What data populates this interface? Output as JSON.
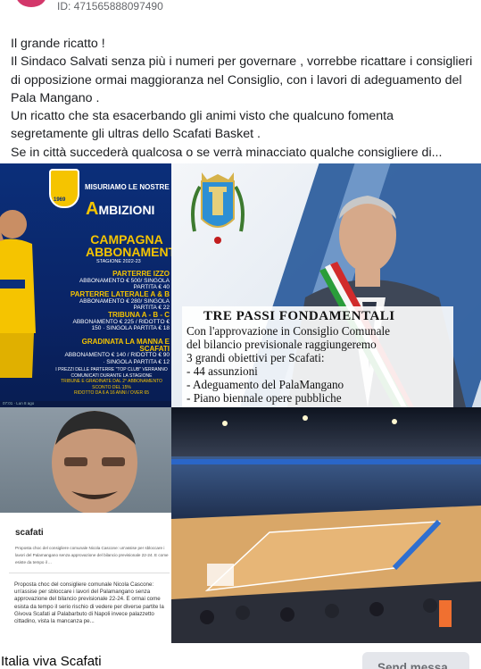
{
  "header": {
    "post_id": "ID: 471565888097490"
  },
  "post": {
    "lines": [
      "Il grande ricatto !",
      "Il Sindaco Salvati senza più i numeri per governare , vorrebbe ricattare i consiglieri",
      "di opposizione ormai maggioranza nel Consiglio, con i lavori di adeguamento del",
      "Pala Mangano .",
      "Un ricatto che sta esacerbando gli animi visto che qualcuno fomenta",
      "segretamente gli ultras dello Scafati Basket .",
      "Se in città succederà qualcosa o se verrà minacciato qualche consigliere di..."
    ]
  },
  "poster": {
    "badge": "SCAFATI BASKET",
    "year": "1969",
    "slogan_small": "MISURIAMO LE NOSTRE",
    "slogan_big": "MBIZIONI",
    "slogan_letter": "A",
    "campaign": "CAMPAGNA ABBONAMENTI",
    "season": "STAGIONE 2022-23",
    "rows": [
      {
        "head": "PARTERRE IZZO",
        "detail": "ABBONAMENTO € 500/ SINGOLA PARTITA € 40"
      },
      {
        "head": "PARTERRE LATERALE A & B",
        "detail": "ABBONAMENTO € 280/ SINGOLA PARTITA € 22"
      },
      {
        "head": "TRIBUNA A - B - C",
        "detail": "ABBONAMENTO € 225 / RIDOTTO € 150 · SINGOLA PARTITA € 18"
      },
      {
        "head": "GRADINATA LA MANNA E SCAFATI",
        "detail": "ABBONAMENTO € 140 / RIDOTTO € 90 · SINGOLA PARTITA € 12"
      }
    ],
    "footer1": "I PREZZI DELLE PARTERRE \"TOP CLUB\" VERRANNO COMUNICATI DURANTE LA STAGIONE",
    "footer2": "TRIBUNE E GRADINATE DAL 2° ABBONAMENTO SCONTO DEL 15%",
    "footer3": "RIDOTTO DA 6 A 16 ANNI / OVER 65",
    "status": "07:01 · Lun 8 ago"
  },
  "municipality": {
    "title": "TRE PASSI FONDAMENTALI",
    "lines": [
      "Con l'approvazione in Consiglio Comunale",
      "del bilancio previsionale raggiungeremo",
      "3 grandi obiettivi per Scafati:",
      "- 44 assunzioni",
      "- Adeguamento del PalaMangano",
      "- Piano biennale opere pubbliche"
    ]
  },
  "article": {
    "site": "scafati",
    "summary": "Proposta choc del consigliere comunale Nicola Cascone: un'assise per sbloccare i lavori del Palamangano senza approvazione del bilancio previsionale 22-24. E come esiste da tempo il ...",
    "body": "Proposta choc del consigliere comunale Nicola Cascone: un'assise per sbloccare i lavori del Palamangano senza approvazione del bilancio previsionale 22-24. E ormai come esista da tempo il serio rischio di vedere per diverse partite la Givova Scafati al Palabarbuto di Napoli invece palazzetto cittadino, vista la mancanza pe..."
  },
  "footer": {
    "page_name": "Italia viva Scafati",
    "send_label": "Send messa"
  }
}
